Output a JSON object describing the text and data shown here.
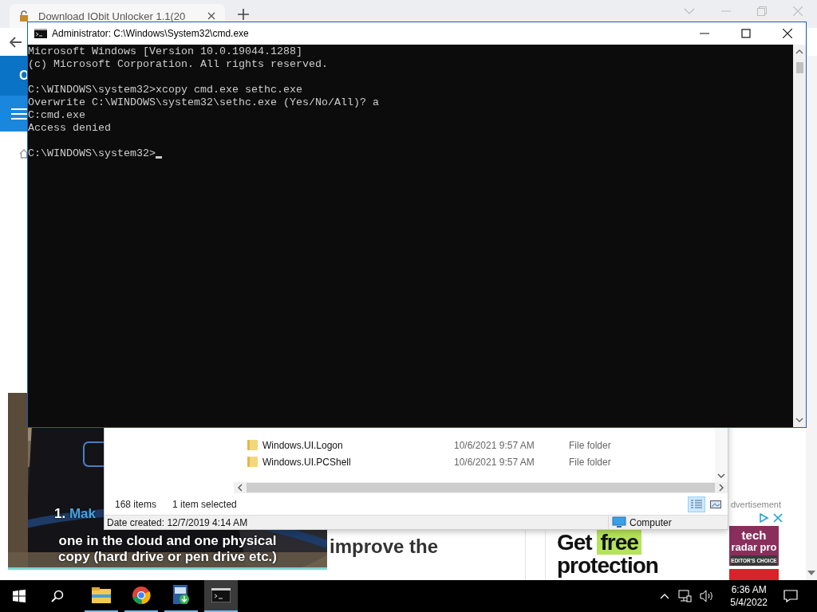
{
  "browser": {
    "tab": {
      "title": "Download IObit Unlocker 1.1(20",
      "selected": true
    },
    "page": {
      "header_letter": "O",
      "video": {
        "caption_number": "1.",
        "caption_cut": "Mak",
        "caption_lines": [
          "one in the cloud and one physical",
          "copy (hard drive or pen drive etc.)"
        ]
      },
      "heading": [
        "improve the"
      ],
      "ad": {
        "label": "dvertisement",
        "headline": [
          "Get",
          "free",
          "protection"
        ],
        "badge": [
          "tech",
          "radar pro"
        ],
        "badge_note": "EDITOR'S CHOICE"
      }
    }
  },
  "explorer": {
    "rows": [
      {
        "name": "Windows.UI.Logon",
        "date": "10/6/2021 9:57 AM",
        "type": "File folder"
      },
      {
        "name": "Windows.UI.PCShell",
        "date": "10/6/2021 9:57 AM",
        "type": "File folder"
      }
    ],
    "status": {
      "count": "168 items",
      "selection": "1 item selected"
    },
    "views": [
      {
        "kind": "details",
        "selected": true
      },
      {
        "kind": "thumbnails",
        "selected": false
      }
    ],
    "details": {
      "date_created": "Date created: 12/7/2019 4:14 AM",
      "location": "Computer"
    }
  },
  "cmd": {
    "title": "Administrator: C:\\Windows\\System32\\cmd.exe",
    "blocks": [
      [
        "Microsoft Windows [Version 10.0.19044.1288]",
        "(c) Microsoft Corporation. All rights reserved."
      ],
      [
        "C:\\WINDOWS\\system32>xcopy cmd.exe sethc.exe",
        "Overwrite C:\\WINDOWS\\system32\\sethc.exe (Yes/No/All)? a",
        "C:cmd.exe",
        "Access denied"
      ]
    ],
    "prompt": "C:\\WINDOWS\\system32>"
  },
  "taskbar": {
    "apps": [
      {
        "kind": "explorer",
        "running": true,
        "active": false
      },
      {
        "kind": "chrome",
        "running": true,
        "active": false
      },
      {
        "kind": "iobit",
        "running": true,
        "active": false
      },
      {
        "kind": "cmd",
        "running": true,
        "active": true
      }
    ],
    "time": "6:36 AM",
    "date": "5/4/2022"
  }
}
